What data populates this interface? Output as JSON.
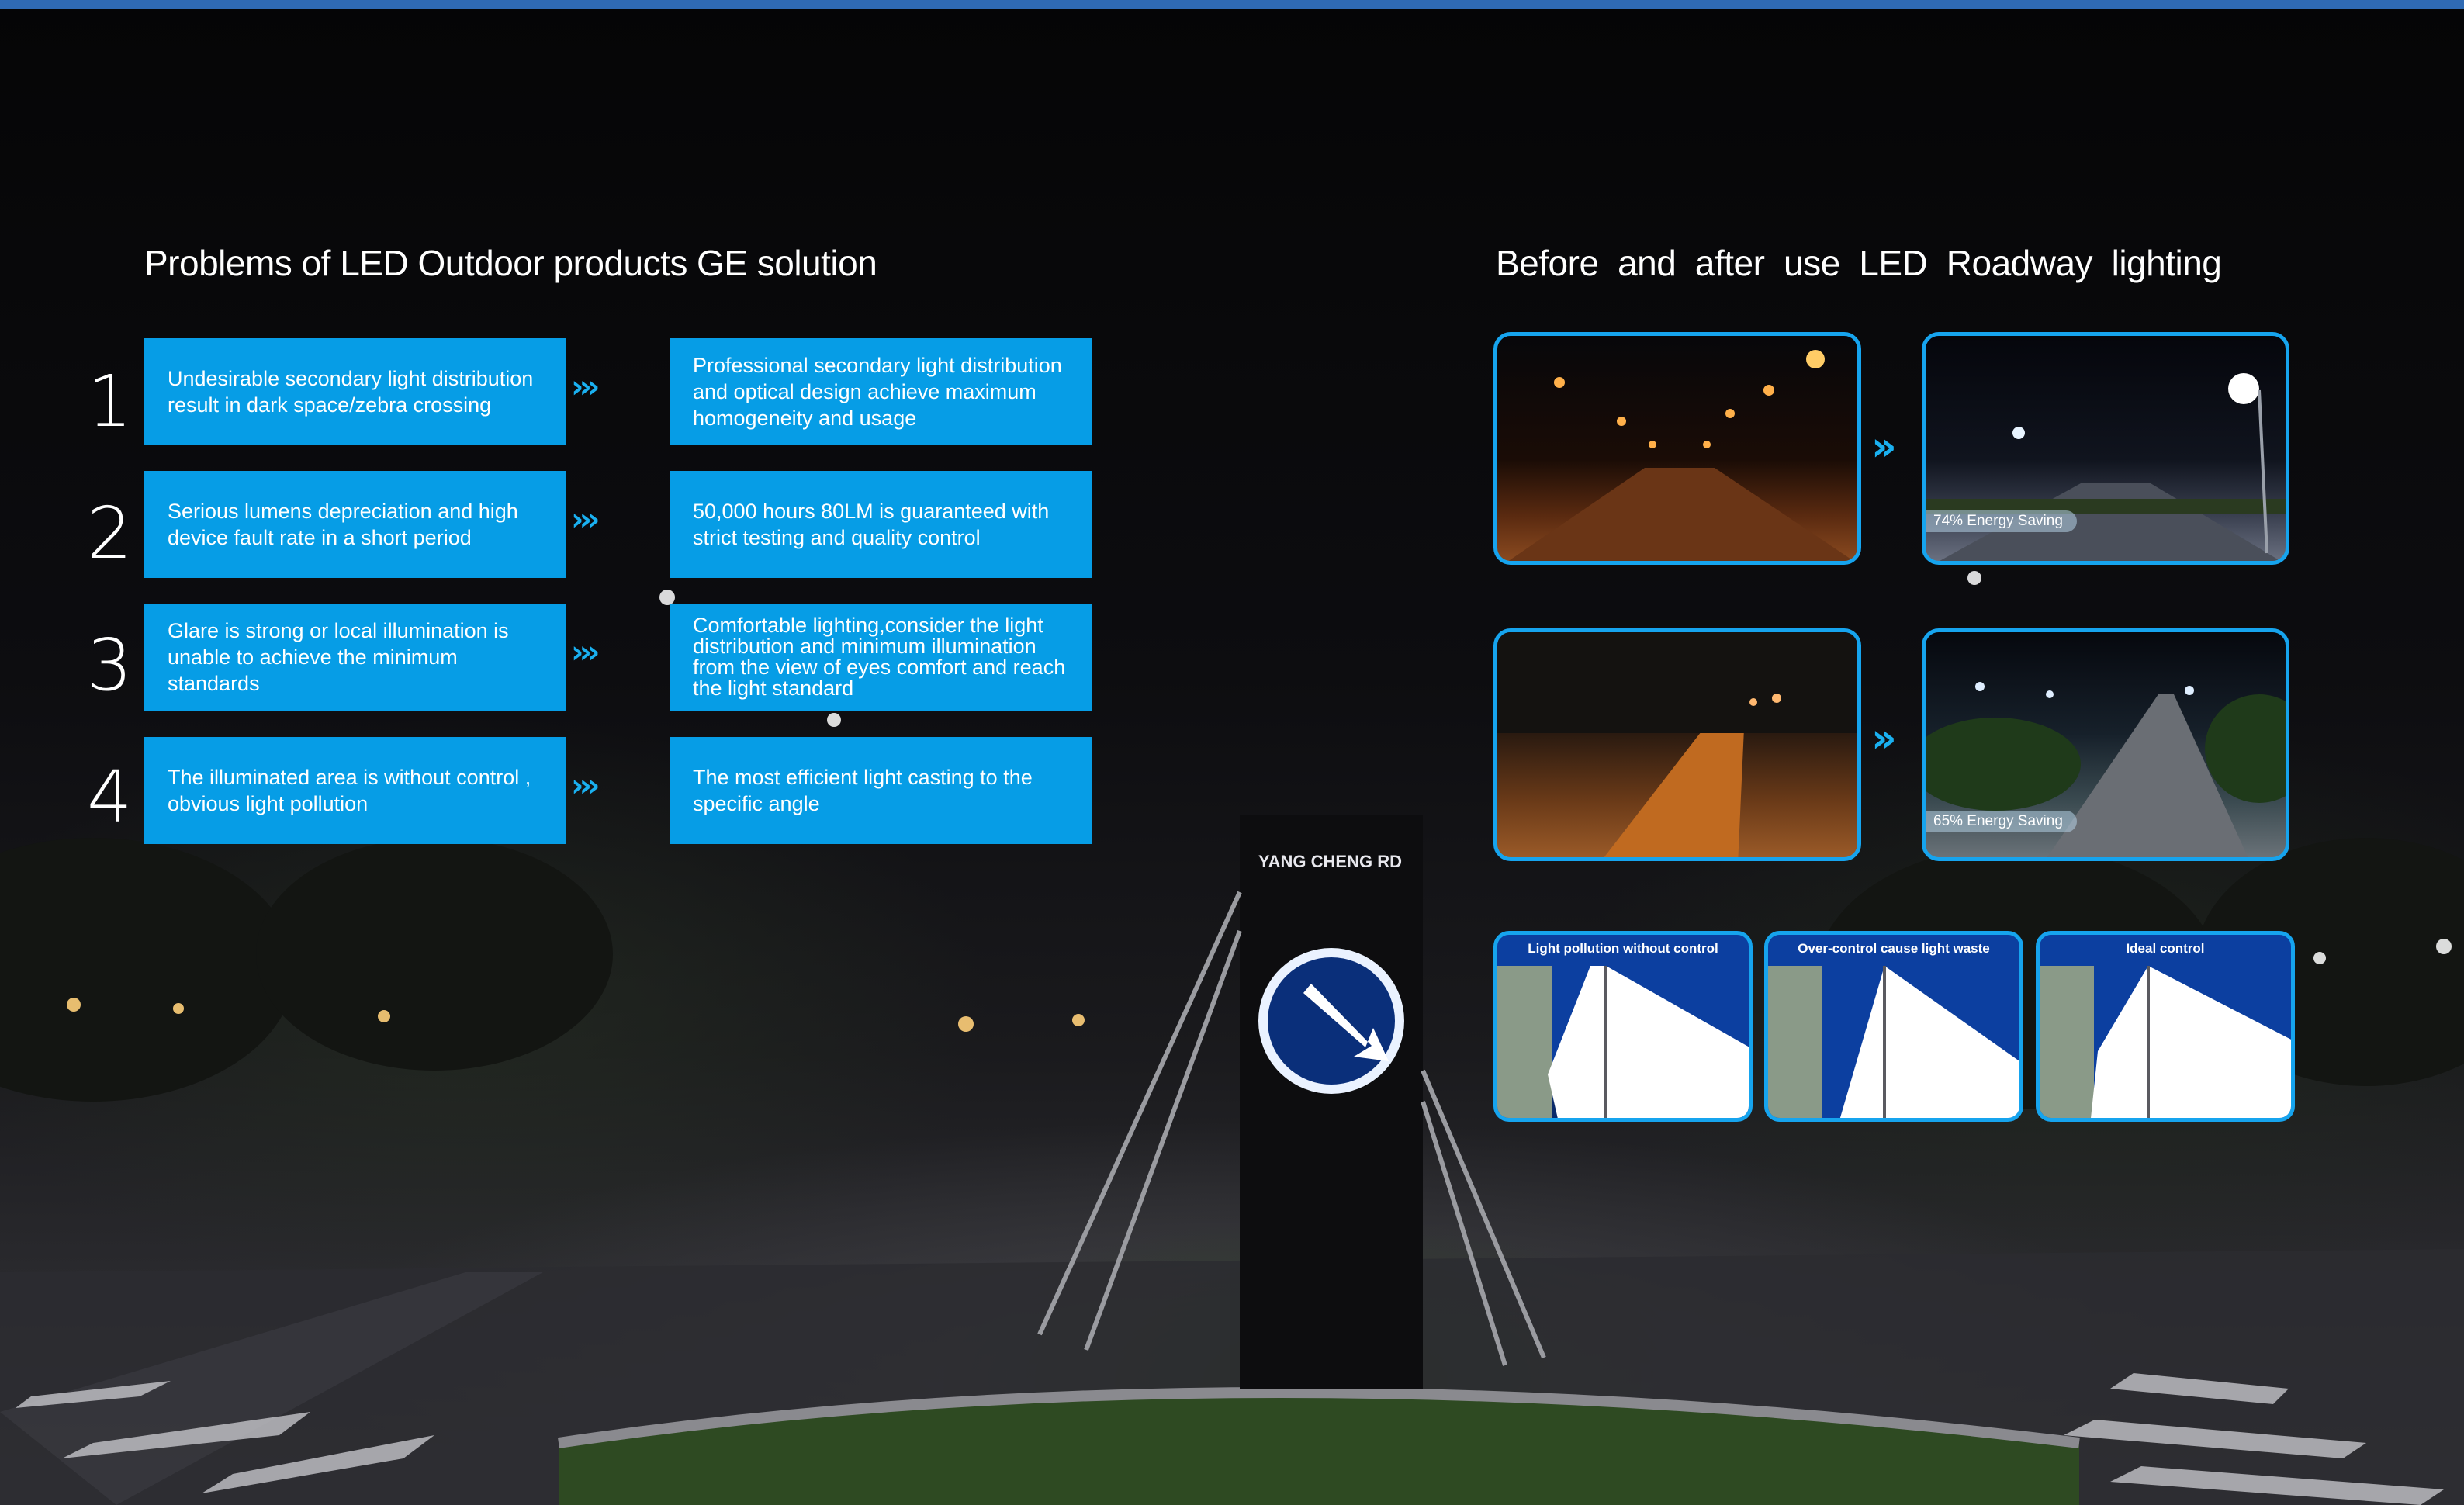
{
  "left_heading": "Problems of LED Outdoor products",
  "middle_heading": "GE solution",
  "right_heading": "Before  and  after  use  LED  Roadway  lighting",
  "items": [
    {
      "number": "1",
      "problem": "Undesirable secondary light distribution result in dark space/zebra crossing",
      "solution": "Professional secondary light distribution and optical design achieve maximum homogeneity and usage"
    },
    {
      "number": "2",
      "problem": "Serious lumens depreciation and high device fault rate in a short period",
      "solution": "50,000 hours 80LM is guaranteed with strict testing and quality control"
    },
    {
      "number": "3",
      "problem": "Glare is strong or local illumination is unable to achieve the minimum standards",
      "solution": "Comfortable lighting,consider the light distribution and minimum illumination from the view of eyes comfort and reach the light standard"
    },
    {
      "number": "4",
      "problem": "The illuminated area is without control , obvious light pollution",
      "solution": "The most efficient light casting to the specific angle"
    }
  ],
  "arrow_glyph": "›››",
  "comparisons": [
    {
      "saving": "74% Energy Saving"
    },
    {
      "saving": "65% Energy Saving"
    }
  ],
  "comparison_arrow": "››",
  "diagrams": [
    {
      "caption": "Light pollution without control"
    },
    {
      "caption": "Over-control cause light waste"
    },
    {
      "caption": "Ideal control"
    }
  ],
  "sign_text": "YANG CHENG RD",
  "colors": {
    "accent": "#069de6",
    "topbar": "#2f6ab4",
    "frame": "#16a4ee"
  }
}
